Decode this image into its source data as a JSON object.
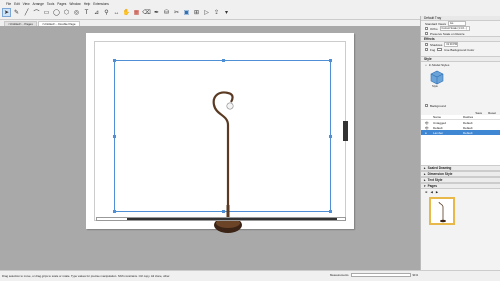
{
  "menu": [
    "File",
    "Edit",
    "View",
    "Arrange",
    "Tools",
    "Pages",
    "Window",
    "Help",
    "Extensions"
  ],
  "tabs": [
    {
      "label": "<Untitled> - Pages"
    },
    {
      "label": "<Untitled> - Double Page"
    }
  ],
  "panel": {
    "title": "Default Tray",
    "sketchup_model": {
      "standard_views_label": "Standard Views",
      "standard_views_value": "Iso",
      "ortho_label": "Ortho",
      "ortho_value": "Current Scale (1:1.6...)",
      "preserve_label": "Preserve Scale on Resize"
    },
    "effects": {
      "title": "Effects",
      "shadows_label": "Shadows",
      "shadows_time": "01:00 PM",
      "fog_label": "Fog",
      "fog_color_label": "Use Background Color"
    },
    "style": {
      "title": "Style",
      "dropdown": "In Model Styles",
      "thumb_label": "Style"
    },
    "background_label": "Background",
    "scenes_controls": {
      "save": "Save",
      "reset": "Reset"
    },
    "layers_table": {
      "headers": [
        "",
        "Name",
        "Dashes"
      ],
      "rows": [
        {
          "name": "Untagged",
          "dashes": "Default"
        },
        {
          "name": "Default",
          "dashes": "Default"
        },
        {
          "name": "Lamber",
          "dashes": "Default"
        }
      ]
    },
    "sections": [
      "Scaled Drawing",
      "Dimension Style",
      "Text Style",
      "Pages"
    ]
  },
  "status": {
    "message": "Drag selection to move, or drag grips to scale or rotate. Type values for precise manipulation. Shift constrains. Ctrl copy. Alt clone, other.",
    "measurements_label": "Measurements",
    "zoom": "91%"
  },
  "colors": {
    "selection": "#4f8fd6",
    "canvas_bg": "#a9a9a9",
    "active_row": "#3f86d3",
    "page_thumb_border": "#e8b94a"
  }
}
